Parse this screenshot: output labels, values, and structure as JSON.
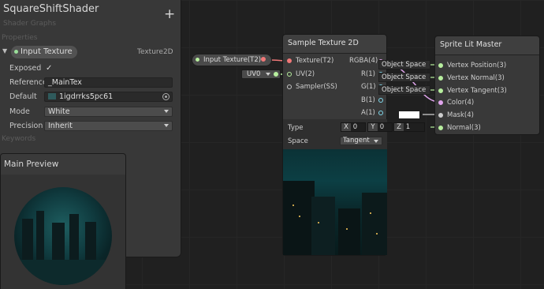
{
  "blackboard": {
    "title": "SquareShiftShader",
    "subtitle": "Shader Graphs",
    "add_label": "+",
    "properties_label": "Properties",
    "keywords_label": "Keywords",
    "property": {
      "name": "Input Texture",
      "type": "Texture2D",
      "exposed_label": "Exposed",
      "exposed_value": "✓",
      "reference_label": "Reference",
      "reference_value": "_MainTex",
      "default_label": "Default",
      "default_value": "1igdrrks5pc61",
      "mode_label": "Mode",
      "mode_value": "White",
      "precision_label": "Precision",
      "precision_value": "Inherit"
    }
  },
  "preview": {
    "title": "Main Preview"
  },
  "input_node": {
    "label": "Input Texture(T2)"
  },
  "uv_node": {
    "label": "UV0"
  },
  "sample_node": {
    "title": "Sample Texture 2D",
    "inputs": [
      "Texture(T2)",
      "UV(2)",
      "Sampler(SS)"
    ],
    "outputs": [
      "RGBA(4)",
      "R(1)",
      "G(1)",
      "B(1)",
      "A(1)"
    ],
    "type_label": "Type",
    "space_label": "Space",
    "space_value": "Tangent",
    "x_label": "X",
    "x_value": "0",
    "y_label": "Y",
    "y_value": "0",
    "z_label": "Z",
    "z_value": "1"
  },
  "master_node": {
    "title": "Sprite Lit Master",
    "inputs": [
      "Vertex Position(3)",
      "Vertex Normal(3)",
      "Vertex Tangent(3)",
      "Color(4)",
      "Mask(4)",
      "Normal(3)"
    ],
    "space_values": [
      "Object Space",
      "Object Space",
      "Object Space"
    ]
  },
  "colors": {
    "texture_port": "#f07878",
    "vector3_port": "#b7ee9e",
    "vector4_port": "#e0a4ec",
    "float_port": "#80d8ec"
  }
}
